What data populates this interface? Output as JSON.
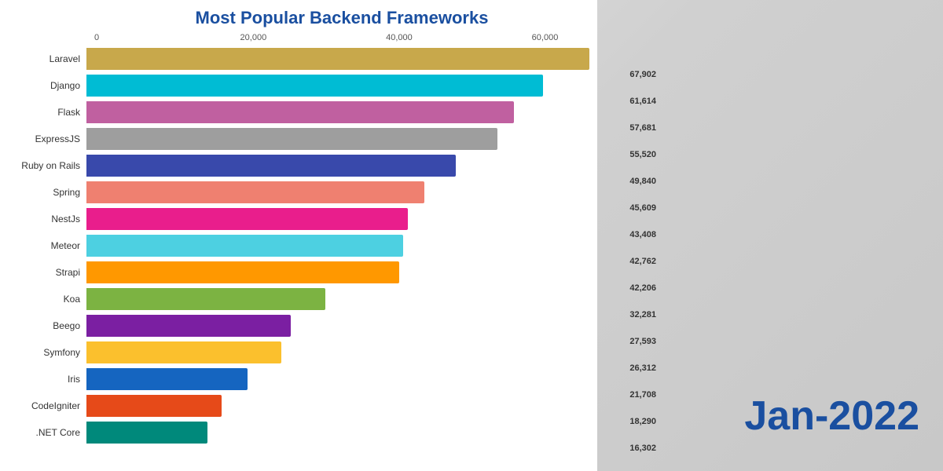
{
  "title": "Most Popular Backend Frameworks",
  "date_label": "Jan-2022",
  "axis": {
    "labels": [
      "0",
      "20,000",
      "40,000",
      "60,000"
    ],
    "max": 67902
  },
  "bars": [
    {
      "name": "Laravel",
      "value": 67902,
      "label": "67,902",
      "color": "#c8a84b",
      "icon": "🔶"
    },
    {
      "name": "Django",
      "value": 61614,
      "label": "61,614",
      "color": "#00bcd4",
      "icon": "🟦"
    },
    {
      "name": "Flask",
      "value": 57681,
      "label": "57,681",
      "color": "#c060a0",
      "icon": "🖤"
    },
    {
      "name": "ExpressJS",
      "value": 55520,
      "label": "55,520",
      "color": "#9e9e9e",
      "icon": "⚙️"
    },
    {
      "name": "Ruby on Rails",
      "value": 49840,
      "label": "49,840",
      "color": "#3949ab",
      "icon": "💎"
    },
    {
      "name": "Spring",
      "value": 45609,
      "label": "45,609",
      "color": "#ef8070",
      "icon": "🌿"
    },
    {
      "name": "NestJs",
      "value": 43408,
      "label": "43,408",
      "color": "#e91e8c",
      "icon": "🔥"
    },
    {
      "name": "Meteor",
      "value": 42762,
      "label": "42,762",
      "color": "#4dd0e1",
      "icon": "☄️"
    },
    {
      "name": "Strapi",
      "value": 42206,
      "label": "42,206",
      "color": "#ff9800",
      "icon": "🥘"
    },
    {
      "name": "Koa",
      "value": 32281,
      "label": "32,281",
      "color": "#7cb342",
      "icon": "🍃"
    },
    {
      "name": "Beego",
      "value": 27593,
      "label": "27,593",
      "color": "#7b1fa2",
      "icon": "🐝"
    },
    {
      "name": "Symfony",
      "value": 26312,
      "label": "26,312",
      "color": "#fbc02d",
      "icon": "⬛"
    },
    {
      "name": "Iris",
      "value": 21708,
      "label": "21,708",
      "color": "#1565c0",
      "icon": "👁️"
    },
    {
      "name": "CodeIgniter",
      "value": 18290,
      "label": "18,290",
      "color": "#e64a19",
      "icon": "🔥"
    },
    {
      "name": ".NET Core",
      "value": 16302,
      "label": "16,302",
      "color": "#00897b",
      "icon": "🔵"
    }
  ]
}
